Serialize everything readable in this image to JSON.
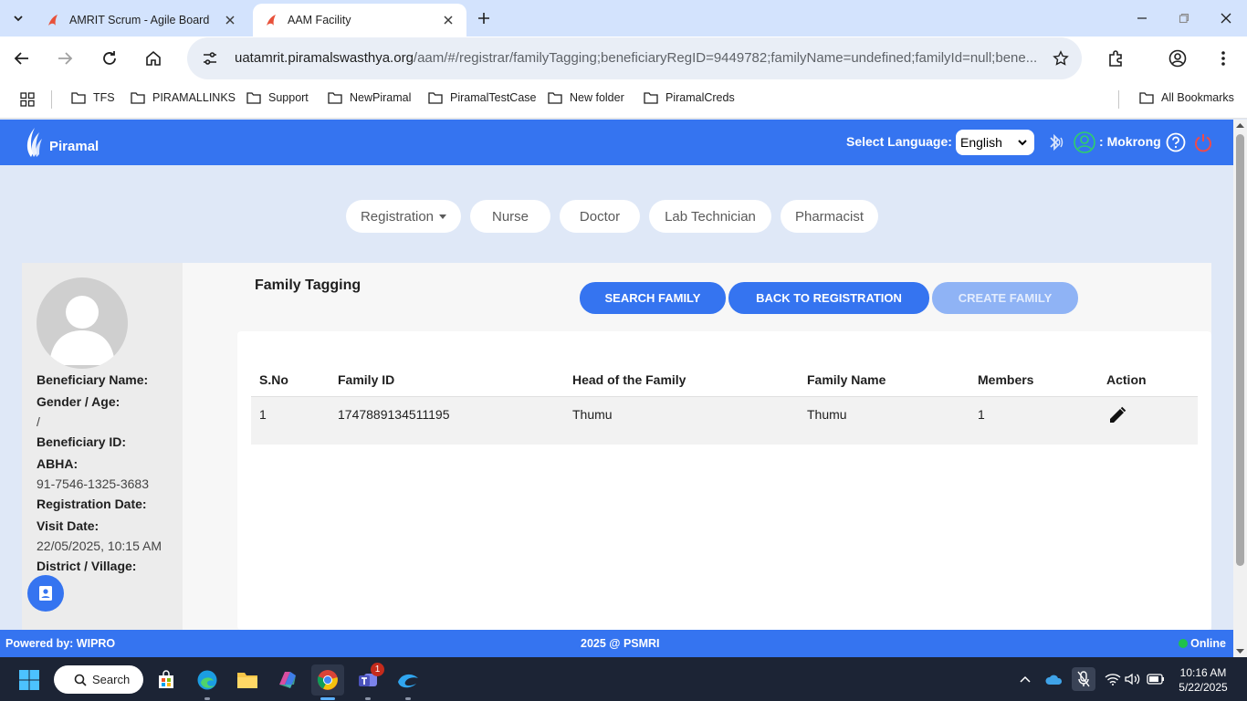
{
  "browser": {
    "tabs": [
      {
        "title": "AMRIT Scrum - Agile Board",
        "active": false
      },
      {
        "title": "AAM Facility",
        "active": true
      }
    ],
    "url_host": "uatamrit.piramalswasthya.org",
    "url_path": "/aam/#/registrar/familyTagging;beneficiaryRegID=9449782;familyName=undefined;familyId=null;bene...",
    "bookmarks": [
      "TFS",
      "PIRAMALLINKS",
      "Support",
      "NewPiramal",
      "PiramalTestCase",
      "New folder",
      "PiramalCreds"
    ],
    "all_bookmarks": "All Bookmarks"
  },
  "app": {
    "logo_text": "Piramal",
    "language_label": "Select Language:",
    "language_value": "English",
    "user_prefix": ":",
    "user_name": "Mokrong",
    "brand_color": "#3574f0"
  },
  "nav": {
    "roles": [
      "Registration",
      "Nurse",
      "Doctor",
      "Lab Technician",
      "Pharmacist"
    ]
  },
  "profile": {
    "beneficiary_name_label": "Beneficiary Name:",
    "gender_age_label": "Gender / Age:",
    "gender_age_value": "/",
    "beneficiary_id_label": "Beneficiary ID:",
    "abha_label": "ABHA:",
    "abha_value": "91-7546-1325-3683",
    "registration_date_label": "Registration Date:",
    "visit_date_label": "Visit Date:",
    "visit_date_value": "22/05/2025, 10:15 AM",
    "district_village_label": "District / Village:"
  },
  "main": {
    "title": "Family Tagging",
    "buttons": {
      "search_family": "SEARCH FAMILY",
      "back_to_registration": "BACK TO REGISTRATION",
      "create_family": "CREATE FAMILY"
    },
    "table": {
      "headers": [
        "S.No",
        "Family ID",
        "Head of the Family",
        "Family Name",
        "Members",
        "Action"
      ],
      "rows": [
        {
          "sno": "1",
          "family_id": "1747889134511195",
          "head": "Thumu",
          "family_name": "Thumu",
          "members": "1",
          "action": "edit-icon"
        }
      ]
    }
  },
  "footer": {
    "powered_by": "Powered by: WIPRO",
    "copyright": "2025 @ PSMRI",
    "status": "Online",
    "status_color": "#1fc24b"
  },
  "taskbar": {
    "search_label": "Search",
    "teams_badge": "1",
    "time": "10:16 AM",
    "date": "5/22/2025"
  }
}
